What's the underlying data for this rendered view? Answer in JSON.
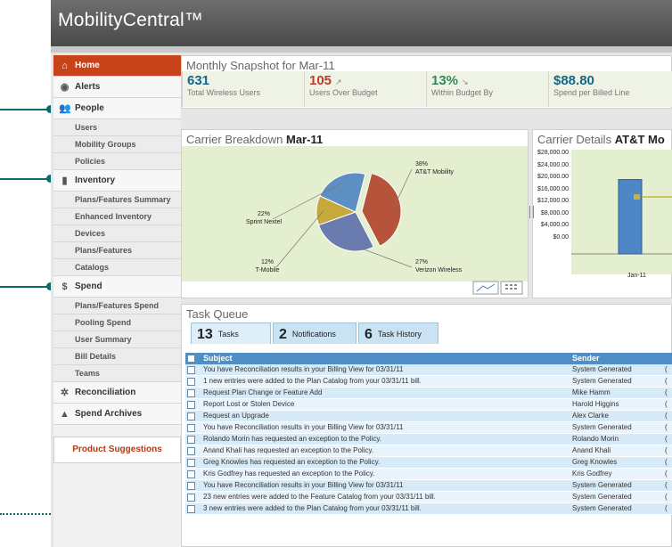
{
  "app": {
    "title": "MobilityCentral™"
  },
  "sidebar": {
    "items": [
      {
        "label": "Home",
        "type": "top",
        "icon": "home-icon",
        "glyph": "⌂",
        "active": true
      },
      {
        "label": "Alerts",
        "type": "top",
        "icon": "alerts-icon",
        "glyph": "◉"
      },
      {
        "label": "People",
        "type": "top",
        "icon": "people-icon",
        "glyph": "👥"
      },
      {
        "label": "Users",
        "type": "sub"
      },
      {
        "label": "Mobility Groups",
        "type": "sub"
      },
      {
        "label": "Policies",
        "type": "sub"
      },
      {
        "label": "Inventory",
        "type": "top",
        "icon": "phone-icon",
        "glyph": "▮"
      },
      {
        "label": "Plans/Features Summary",
        "type": "sub"
      },
      {
        "label": "Enhanced Inventory",
        "type": "sub"
      },
      {
        "label": "Devices",
        "type": "sub"
      },
      {
        "label": "Plans/Features",
        "type": "sub"
      },
      {
        "label": "Catalogs",
        "type": "sub"
      },
      {
        "label": "Spend",
        "type": "top",
        "icon": "dollar-icon",
        "glyph": "$"
      },
      {
        "label": "Plans/Features Spend",
        "type": "sub"
      },
      {
        "label": "Pooling Spend",
        "type": "sub"
      },
      {
        "label": "User Summary",
        "type": "sub"
      },
      {
        "label": "Bill Details",
        "type": "sub"
      },
      {
        "label": "Teams",
        "type": "sub"
      },
      {
        "label": "Reconciliation",
        "type": "top",
        "icon": "gear-icon",
        "glyph": "✲"
      },
      {
        "label": "Spend Archives",
        "type": "top",
        "icon": "archive-icon",
        "glyph": "▲"
      }
    ],
    "suggestions_label": "Product Suggestions"
  },
  "snapshot": {
    "title": "Monthly Snapshot for Mar-11",
    "kpis": [
      {
        "value": "631",
        "trend": "",
        "label": "Total Wireless Users",
        "color": "#16668c"
      },
      {
        "value": "105",
        "trend": "↗",
        "label": "Users Over Budget",
        "color": "#c0392b"
      },
      {
        "value": "13%",
        "trend": "↘",
        "label": "Within Budget By",
        "color": "#2e8b57"
      },
      {
        "value": "$88.80",
        "trend": "",
        "label": "Spend per Billed Line",
        "color": "#16668c"
      }
    ]
  },
  "carrier_breakdown": {
    "title": "Carrier Breakdown",
    "period": "Mar-11",
    "slices": [
      {
        "pct": "38%",
        "name": "AT&T Mobility",
        "value": 38,
        "color": "#b5543a"
      },
      {
        "pct": "27%",
        "name": "Verizon Wireless",
        "value": 27,
        "color": "#6a7bb0"
      },
      {
        "pct": "12%",
        "name": "T-Mobile",
        "value": 12,
        "color": "#c7a83d"
      },
      {
        "pct": "22%",
        "name": "Sprint Nextel",
        "value": 22,
        "color": "#5e8fc2"
      }
    ]
  },
  "carrier_details": {
    "title": "Carrier Details",
    "carrier": "AT&T Mo",
    "y_ticks": [
      "$28,000.00",
      "$24,000.00",
      "$20,000.00",
      "$16,000.00",
      "$12,000.00",
      "$8,000.00",
      "$4,000.00",
      "$0.00"
    ],
    "x_label": "Jan-11"
  },
  "chart_data": [
    {
      "type": "pie",
      "title": "Carrier Breakdown",
      "categories": [
        "AT&T Mobility",
        "Verizon Wireless",
        "T-Mobile",
        "Sprint Nextel"
      ],
      "values": [
        38,
        27,
        12,
        22
      ]
    },
    {
      "type": "bar",
      "title": "Carrier Details",
      "categories": [
        "Jan-11"
      ],
      "values": [
        20500
      ],
      "ylim": [
        0,
        28000
      ]
    }
  ],
  "task_queue": {
    "title": "Task Queue",
    "tabs": [
      {
        "count": "13",
        "label": "Tasks",
        "active": true
      },
      {
        "count": "2",
        "label": "Notifications"
      },
      {
        "count": "6",
        "label": "Task History"
      }
    ],
    "columns": {
      "subject": "Subject",
      "sender": "Sender"
    },
    "rows": [
      {
        "subject": "You have Reconciliation results in your Billing View for 03/31/11",
        "sender": "System Generated",
        "last": "("
      },
      {
        "subject": "1 new entries were added to the Plan Catalog from your 03/31/11 bill.",
        "sender": "System Generated",
        "last": "("
      },
      {
        "subject": "Request Plan Change or Feature Add",
        "sender": "Mike Hamm",
        "last": "("
      },
      {
        "subject": "Report Lost or Stolen Device",
        "sender": "Harold Higgins",
        "last": "("
      },
      {
        "subject": "Request an Upgrade",
        "sender": "Alex Clarke",
        "last": "("
      },
      {
        "subject": "You have Reconciliation results in your Billing View for 03/31/11",
        "sender": "System Generated",
        "last": "("
      },
      {
        "subject": "Rolando Morin has requested an exception to the Policy.",
        "sender": "Rolando Morin",
        "last": "("
      },
      {
        "subject": "Anand Khali has requested an exception to the Policy.",
        "sender": "Anand Khali",
        "last": "("
      },
      {
        "subject": "Greg Knowles has requested an exception to the Policy.",
        "sender": "Greg Knowles",
        "last": "("
      },
      {
        "subject": "Kris Godfrey has requested an exception to the Policy.",
        "sender": "Kris Godfrey",
        "last": "("
      },
      {
        "subject": "You have Reconciliation results in your Billing View for 03/31/11",
        "sender": "System Generated",
        "last": "("
      },
      {
        "subject": "23 new entries were added to the Feature Catalog from your 03/31/11 bill.",
        "sender": "System Generated",
        "last": "("
      },
      {
        "subject": "3 new entries were added to the Plan Catalog from your 03/31/11 bill.",
        "sender": "System Generated",
        "last": "("
      }
    ]
  }
}
